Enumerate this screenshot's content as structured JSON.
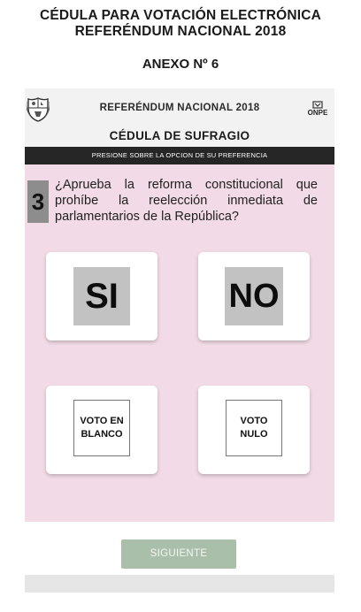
{
  "document": {
    "title_line1": "CÉDULA PARA VOTACIÓN ELECTRÓNICA",
    "title_line2": "REFERÉNDUM NACIONAL 2018",
    "annex": "ANEXO Nº 6"
  },
  "ballot": {
    "header_title": "REFERÉNDUM NACIONAL 2018",
    "logo_text": "ONPE",
    "subtitle": "CÉDULA DE SUFRAGIO",
    "instruction": "PRESIONE SOBRE LA OPCION DE SU PREFERENCIA",
    "question_number": "3",
    "question_text": "¿Aprueba la reforma constitucional que prohíbe la reelección inmediata de parlamentarios de la República?",
    "options": {
      "yes": "SI",
      "no": "NO",
      "blank_line1": "VOTO EN",
      "blank_line2": "BLANCO",
      "null_line1": "VOTO",
      "null_line2": "NULO"
    },
    "next_button": "SIGUIENTE"
  },
  "colors": {
    "ballot_background": "#f2dbe6",
    "instruction_bar": "#262626",
    "next_button": "#a9bfa9",
    "option_mark": "#c2c2c2"
  },
  "icons": [
    "national-shield-icon",
    "onpe-logo-icon"
  ]
}
